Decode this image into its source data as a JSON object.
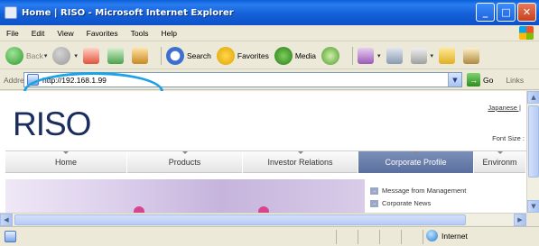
{
  "window": {
    "title": "Home | RISO - Microsoft Internet Explorer"
  },
  "menu": [
    "File",
    "Edit",
    "View",
    "Favorites",
    "Tools",
    "Help"
  ],
  "toolbar": {
    "back_label": "Back",
    "search_label": "Search",
    "favorites_label": "Favorites",
    "media_label": "Media"
  },
  "address": {
    "label": "Address",
    "url": "http://192.168.1.99",
    "go_label": "Go",
    "links_label": "Links"
  },
  "page": {
    "logo": "RISO",
    "language_link": "Japanese",
    "font_size_label": "Font Size :",
    "nav": [
      "Home",
      "Products",
      "Investor Relations",
      "Corporate Profile",
      "Environm"
    ],
    "active_nav": "Corporate Profile",
    "sub_links": [
      "Message from Management",
      "Corporate News"
    ]
  },
  "status": {
    "zone_label": "Internet"
  },
  "colors": {
    "titlebar": "#1460d8",
    "highlight_circle": "#1aa3e6",
    "active_nav": "#6a7fac",
    "logo": "#1a2d5e"
  }
}
